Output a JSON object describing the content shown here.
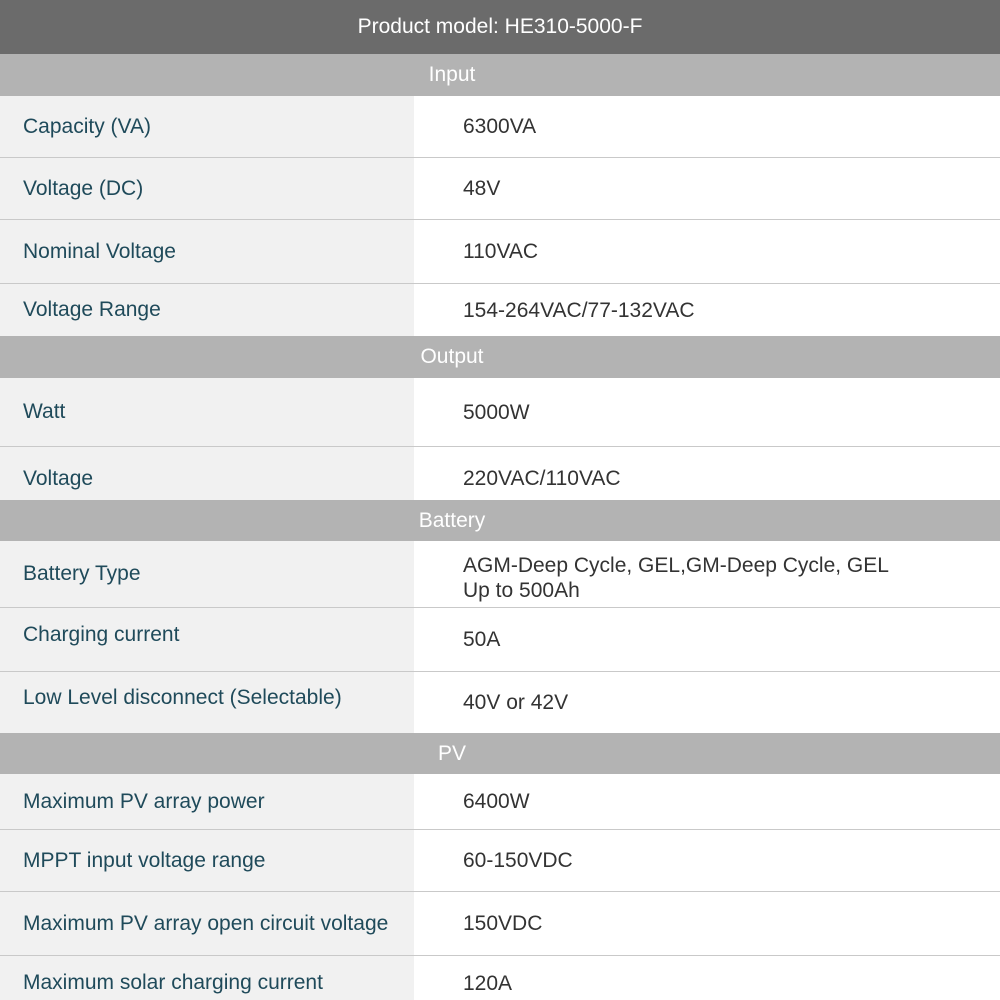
{
  "title": "Product model: HE310-5000-F",
  "sections": {
    "input": {
      "heading": "Input",
      "rows": [
        {
          "label": "Capacity (VA)",
          "value": "6300VA"
        },
        {
          "label": "Voltage (DC)",
          "value": "48V"
        },
        {
          "label": "Nominal Voltage",
          "value": "110VAC"
        },
        {
          "label": "Voltage Range",
          "value": "154-264VAC/77-132VAC"
        }
      ]
    },
    "output": {
      "heading": "Output",
      "rows": [
        {
          "label": "Watt",
          "value": "5000W"
        },
        {
          "label": "Voltage",
          "value": "220VAC/110VAC"
        }
      ]
    },
    "battery": {
      "heading": "Battery",
      "rows": [
        {
          "label": "Battery Type",
          "value": "AGM-Deep Cycle, GEL,GM-Deep Cycle, GEL",
          "value2": "Up to 500Ah"
        },
        {
          "label": "Charging current",
          "value": "50A"
        },
        {
          "label": "Low Level disconnect (Selectable)",
          "value": "40V or 42V"
        }
      ]
    },
    "pv": {
      "heading": "PV",
      "rows": [
        {
          "label": "Maximum PV array power",
          "value": "6400W"
        },
        {
          "label": "MPPT input voltage range",
          "value": "60-150VDC"
        },
        {
          "label": "Maximum PV array open circuit voltage",
          "value": "150VDC"
        },
        {
          "label": "Maximum solar charging current",
          "value": "120A"
        }
      ]
    }
  }
}
